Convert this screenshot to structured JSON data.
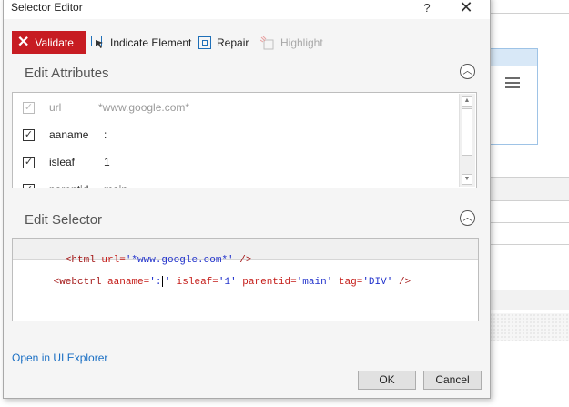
{
  "dialog": {
    "title": "Selector Editor",
    "help_label": "?",
    "close_label": "✕"
  },
  "toolbar": {
    "validate_label": "Validate",
    "indicate_label": "Indicate Element",
    "repair_label": "Repair",
    "highlight_label": "Highlight"
  },
  "edit_attributes": {
    "title": "Edit Attributes",
    "rows": [
      {
        "name": "url",
        "value": "*www.google.com*",
        "checked": true,
        "enabled": false
      },
      {
        "name": "aaname",
        "value": ":",
        "checked": true,
        "enabled": true
      },
      {
        "name": "isleaf",
        "value": "1",
        "checked": true,
        "enabled": true
      },
      {
        "name": "parentid",
        "value": "main",
        "checked": true,
        "enabled": true
      }
    ]
  },
  "edit_selector": {
    "title": "Edit Selector",
    "line1": {
      "open": "<html ",
      "attr": "url=",
      "val": "'*www.google.com*'",
      "close": " />"
    },
    "line2": {
      "open": "<webctrl ",
      "a1": "aaname=",
      "v1a": "':",
      "v1b": "'",
      "a2": " isleaf=",
      "v2": "'1'",
      "a3": " parentid=",
      "v3": "'main'",
      "a4": " tag=",
      "v4": "'DIV'",
      "close": " />"
    }
  },
  "footer": {
    "explorer_link": "Open in UI Explorer",
    "ok_label": "OK",
    "cancel_label": "Cancel"
  },
  "colors": {
    "validate_bg": "#c71c22",
    "link": "#1a6fc4",
    "accent_blue": "#1e6fb8"
  },
  "icons": [
    "close-x-icon",
    "cursor-select-icon",
    "repair-icon",
    "highlight-icon",
    "collapse-chevron-icon",
    "hamburger-menu-icon"
  ]
}
